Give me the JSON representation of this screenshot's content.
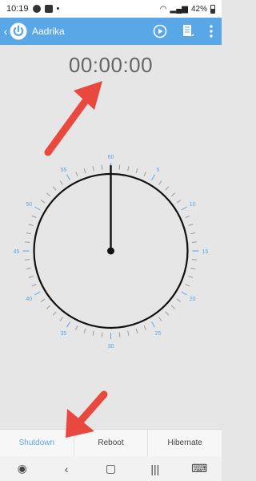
{
  "status": {
    "time": "10:19",
    "battery": "42%"
  },
  "app": {
    "title": "Aadrika"
  },
  "timer": {
    "display": "00:00:00"
  },
  "dial": {
    "labels": [
      "60",
      "5",
      "10",
      "15",
      "20",
      "25",
      "30",
      "35",
      "40",
      "45",
      "50",
      "55"
    ]
  },
  "tabs": [
    {
      "label": "Shutdown",
      "active": true
    },
    {
      "label": "Reboot",
      "active": false
    },
    {
      "label": "Hibernate",
      "active": false
    }
  ],
  "nav": {
    "items": [
      "recents-icon",
      "back-icon",
      "home-icon",
      "menu-icon",
      "accessibility-icon"
    ]
  },
  "colors": {
    "appbar": "#5aa7e8",
    "accent": "#5aa7e8",
    "annotation": "#e8483e",
    "dial": "#111111"
  }
}
